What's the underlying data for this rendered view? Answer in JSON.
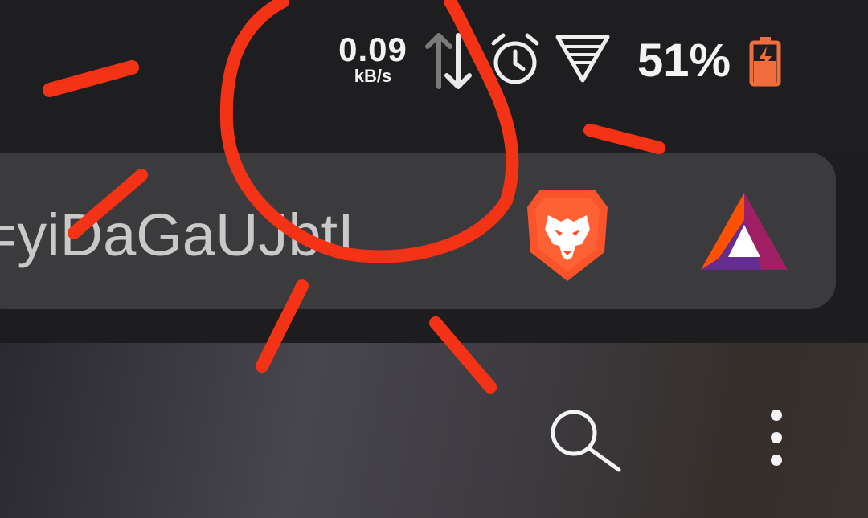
{
  "status_bar": {
    "network_speed_value": "0.09",
    "network_speed_unit": "kB/s",
    "battery_percent": "51%",
    "icons": [
      "data-transfer-icon",
      "alarm-clock-icon",
      "wifi-icon",
      "battery-charging-icon"
    ],
    "battery_color": "#f26d3d"
  },
  "url_bar": {
    "url_fragment": "=yiDaGaUJbtI",
    "icons": [
      "brave-lion-icon",
      "bat-rewards-icon"
    ],
    "brave_color": "#fb542b"
  },
  "toolbar": {
    "icons": [
      "search-icon",
      "more-menu-icon"
    ]
  },
  "annotation": {
    "stroke_color": "#f43316",
    "description_icon": "red-sun-circle-annotation"
  }
}
